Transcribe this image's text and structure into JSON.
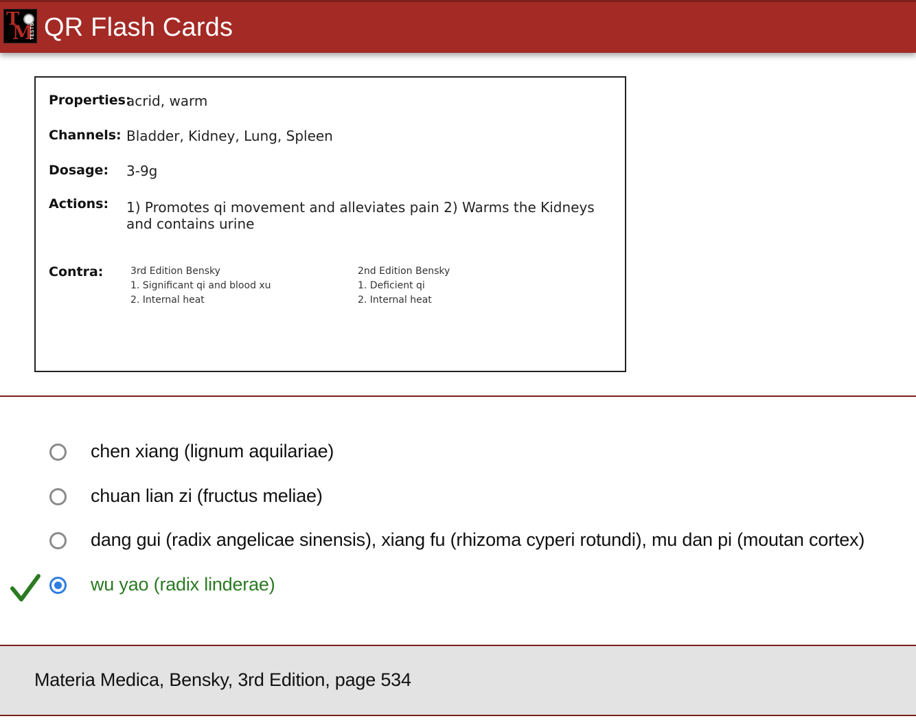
{
  "header": {
    "title": "QR Flash Cards",
    "logo_letters": [
      "T",
      "M"
    ],
    "logo_side_text": "TESTS"
  },
  "card": {
    "properties_label": "Properties:",
    "properties_value": "acrid, warm",
    "channels_label": "Channels:",
    "channels_value": "Bladder, Kidney, Lung, Spleen",
    "dosage_label": "Dosage:",
    "dosage_value": "3-9g",
    "actions_label": "Actions:",
    "actions_value": "1) Promotes qi movement and alleviates pain 2) Warms the Kidneys and contains urine",
    "contra_label": "Contra:",
    "contra_columns": [
      {
        "heading": "3rd Edition Bensky",
        "items": [
          "1. Significant qi and blood xu",
          "2. Internal heat"
        ]
      },
      {
        "heading": "2nd Edition Bensky",
        "items": [
          "1. Deficient qi",
          "2. Internal heat"
        ]
      }
    ]
  },
  "options": [
    {
      "label": "chen xiang (lignum aquilariae)",
      "selected": false,
      "correct": false
    },
    {
      "label": "chuan lian zi (fructus meliae)",
      "selected": false,
      "correct": false
    },
    {
      "label": "dang gui (radix angelicae sinensis), xiang fu (rhizoma cyperi rotundi), mu dan pi (moutan cortex)",
      "selected": false,
      "correct": false
    },
    {
      "label": "wu yao (radix linderae)",
      "selected": true,
      "correct": true
    }
  ],
  "footer": {
    "source": "Materia Medica, Bensky, 3rd Edition, page 534"
  },
  "colors": {
    "header_bg": "#a32a25",
    "correct_text": "#2a7a22",
    "check_mark": "#2a7a22",
    "radio_selected": "#2f7de1",
    "divider": "#7a1e1a",
    "footer_bg": "#e3e3e3"
  },
  "icons": {
    "check": "check-icon",
    "radio": "radio-icon"
  }
}
